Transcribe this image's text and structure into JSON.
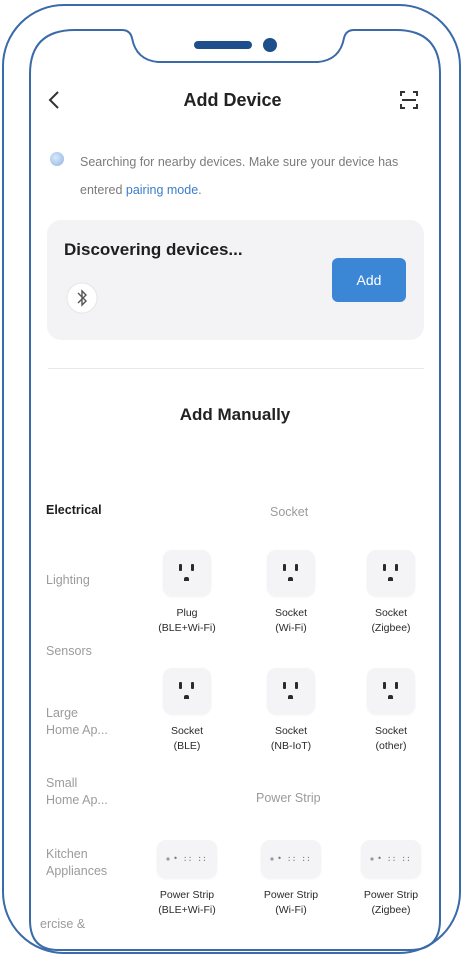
{
  "header": {
    "title": "Add Device"
  },
  "info": {
    "text": "Searching for nearby devices. Make sure your device has entered ",
    "link": "pairing mode",
    "suffix": "."
  },
  "discover": {
    "title": "Discovering devices...",
    "add_label": "Add"
  },
  "manual": {
    "title": "Add Manually"
  },
  "categories": [
    {
      "label": "Electrical",
      "active": true
    },
    {
      "label": "Lighting"
    },
    {
      "label": "Sensors"
    },
    {
      "label": "Large\nHome Ap..."
    },
    {
      "label": "Small\nHome Ap..."
    },
    {
      "label": "Kitchen\nAppliances"
    },
    {
      "label": "ercise &"
    }
  ],
  "groups": [
    {
      "title": "Socket",
      "items": [
        {
          "line1": "Plug",
          "line2": "(BLE+Wi-Fi)",
          "icon": "socket-icon"
        },
        {
          "line1": "Socket",
          "line2": "(Wi-Fi)",
          "icon": "socket-icon"
        },
        {
          "line1": "Socket",
          "line2": "(Zigbee)",
          "icon": "socket-icon"
        },
        {
          "line1": "Socket",
          "line2": "(BLE)",
          "icon": "socket-icon"
        },
        {
          "line1": "Socket",
          "line2": "(NB-IoT)",
          "icon": "socket-icon"
        },
        {
          "line1": "Socket",
          "line2": "(other)",
          "icon": "socket-icon"
        }
      ]
    },
    {
      "title": "Power Strip",
      "items": [
        {
          "line1": "Power Strip",
          "line2": "(BLE+Wi-Fi)",
          "icon": "power-strip-icon"
        },
        {
          "line1": "Power Strip",
          "line2": "(Wi-Fi)",
          "icon": "power-strip-icon"
        },
        {
          "line1": "Power Strip",
          "line2": "(Zigbee)",
          "icon": "power-strip-icon"
        }
      ]
    }
  ],
  "colors": {
    "accent": "#3b87d6",
    "link": "#3b7dc8",
    "frame": "#3a6aa8"
  }
}
